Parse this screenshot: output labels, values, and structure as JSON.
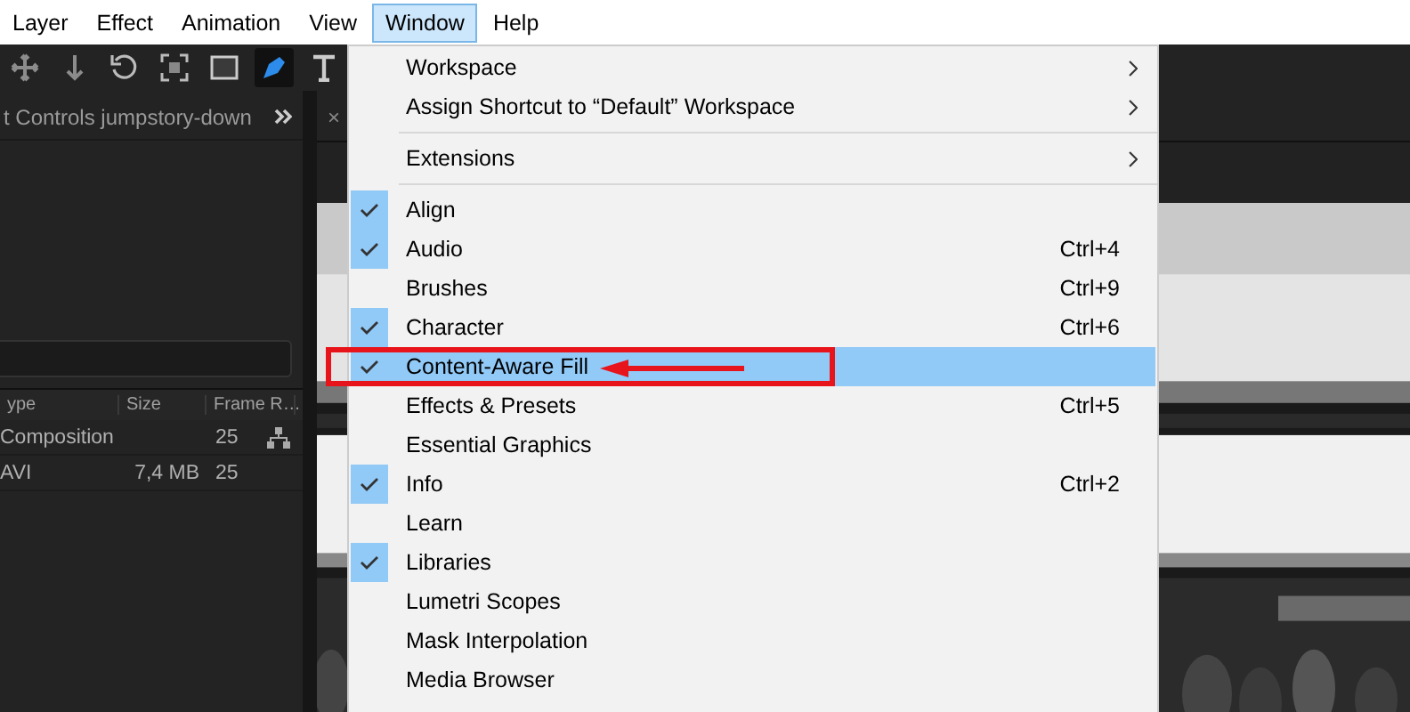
{
  "menu_bar": [
    {
      "label": "Layer",
      "selected": false
    },
    {
      "label": "Effect",
      "selected": false
    },
    {
      "label": "Animation",
      "selected": false
    },
    {
      "label": "View",
      "selected": false
    },
    {
      "label": "Window",
      "selected": true
    },
    {
      "label": "Help",
      "selected": false
    }
  ],
  "toolbar": [
    {
      "kind": "move",
      "selected": false
    },
    {
      "kind": "anchor",
      "selected": false
    },
    {
      "kind": "rotate",
      "selected": false
    },
    {
      "kind": "region",
      "selected": false
    },
    {
      "kind": "rectangle",
      "selected": false
    },
    {
      "kind": "pen",
      "selected": true
    },
    {
      "kind": "text",
      "selected": false
    }
  ],
  "effect_panel": {
    "tab_label": "t Controls jumpstory-down"
  },
  "viewer_panel": {
    "close": "×"
  },
  "project_table": {
    "columns": [
      "ype",
      "Size",
      "Frame R…"
    ],
    "rows": [
      {
        "kind": "composition",
        "cells": [
          "Composition",
          "",
          "25"
        ]
      },
      {
        "kind": "footage",
        "cells": [
          "AVI",
          "7,4 MB",
          "25"
        ]
      }
    ]
  },
  "window_menu": [
    {
      "kind": "submenu",
      "label": "Workspace"
    },
    {
      "kind": "submenu",
      "label": "Assign Shortcut to “Default” Workspace"
    },
    {
      "kind": "separator"
    },
    {
      "kind": "submenu",
      "label": "Extensions"
    },
    {
      "kind": "separator"
    },
    {
      "kind": "item",
      "label": "Align",
      "checked": true,
      "selected": false
    },
    {
      "kind": "item",
      "label": "Audio",
      "checked": true,
      "selected": false,
      "shortcut": "Ctrl+4"
    },
    {
      "kind": "item",
      "label": "Brushes",
      "checked": false,
      "selected": false,
      "shortcut": "Ctrl+9"
    },
    {
      "kind": "item",
      "label": "Character",
      "checked": true,
      "selected": false,
      "shortcut": "Ctrl+6"
    },
    {
      "kind": "item",
      "label": "Content-Aware Fill",
      "checked": true,
      "selected": true
    },
    {
      "kind": "item",
      "label": "Effects & Presets",
      "checked": false,
      "selected": false,
      "shortcut": "Ctrl+5"
    },
    {
      "kind": "item",
      "label": "Essential Graphics",
      "checked": false,
      "selected": false
    },
    {
      "kind": "item",
      "label": "Info",
      "checked": true,
      "selected": false,
      "shortcut": "Ctrl+2"
    },
    {
      "kind": "item",
      "label": "Learn",
      "checked": false,
      "selected": false
    },
    {
      "kind": "item",
      "label": "Libraries",
      "checked": true,
      "selected": false
    },
    {
      "kind": "item",
      "label": "Lumetri Scopes",
      "checked": false,
      "selected": false
    },
    {
      "kind": "item",
      "label": "Mask Interpolation",
      "checked": false,
      "selected": false
    },
    {
      "kind": "item",
      "label": "Media Browser",
      "checked": false,
      "selected": false
    }
  ],
  "annotation": {
    "box": true,
    "arrow": true
  }
}
